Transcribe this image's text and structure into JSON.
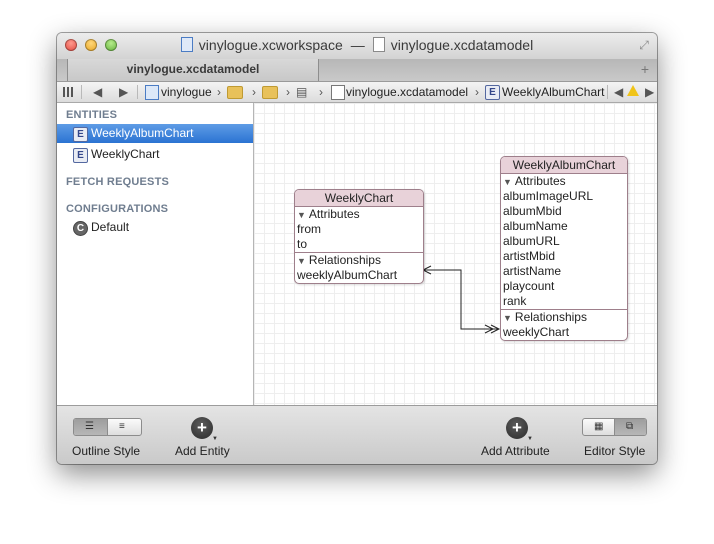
{
  "window": {
    "title_workspace": "vinylogue.xcworkspace",
    "title_separator": "—",
    "title_model": "vinylogue.xcdatamodel"
  },
  "tabbar": {
    "tab_label": "vinylogue.xcdatamodel",
    "add_tab_glyph": "+"
  },
  "jumpbar": {
    "project": "vinylogue",
    "file": "vinylogue.xcdatamodel",
    "entity": "WeeklyAlbumChart",
    "icons": [
      "grid-icon",
      "back-arrow-icon",
      "forward-arrow-icon",
      "project-icon",
      "folder-icon",
      "folder-icon",
      "group-icon",
      "xcdatamodel-icon",
      "entity-icon",
      "warning-icon"
    ]
  },
  "sidebar": {
    "entities_header": "ENTITIES",
    "entities": [
      {
        "badge": "E",
        "label": "WeeklyAlbumChart",
        "selected": true
      },
      {
        "badge": "E",
        "label": "WeeklyChart",
        "selected": false
      }
    ],
    "fetch_header": "FETCH REQUESTS",
    "config_header": "CONFIGURATIONS",
    "configurations": [
      {
        "badge": "C",
        "label": "Default"
      }
    ]
  },
  "diagram": {
    "weekly_chart": {
      "title": "WeeklyChart",
      "attributes_label": "Attributes",
      "attributes": [
        "from",
        "to"
      ],
      "relationships_label": "Relationships",
      "relationships": [
        "weeklyAlbumChart"
      ]
    },
    "weekly_album_chart": {
      "title": "WeeklyAlbumChart",
      "attributes_label": "Attributes",
      "attributes": [
        "albumImageURL",
        "albumMbid",
        "albumName",
        "albumURL",
        "artistMbid",
        "artistName",
        "playcount",
        "rank"
      ],
      "relationships_label": "Relationships",
      "relationships": [
        "weeklyChart"
      ]
    },
    "colors": {
      "entity_header": "#e8d2d9",
      "entity_border": "#9e7f8b",
      "selection": "#2b73d2"
    }
  },
  "bottombar": {
    "outline_style_label": "Outline Style",
    "add_entity_label": "Add Entity",
    "add_attribute_label": "Add Attribute",
    "editor_style_label": "Editor Style",
    "add_glyph": "+"
  }
}
